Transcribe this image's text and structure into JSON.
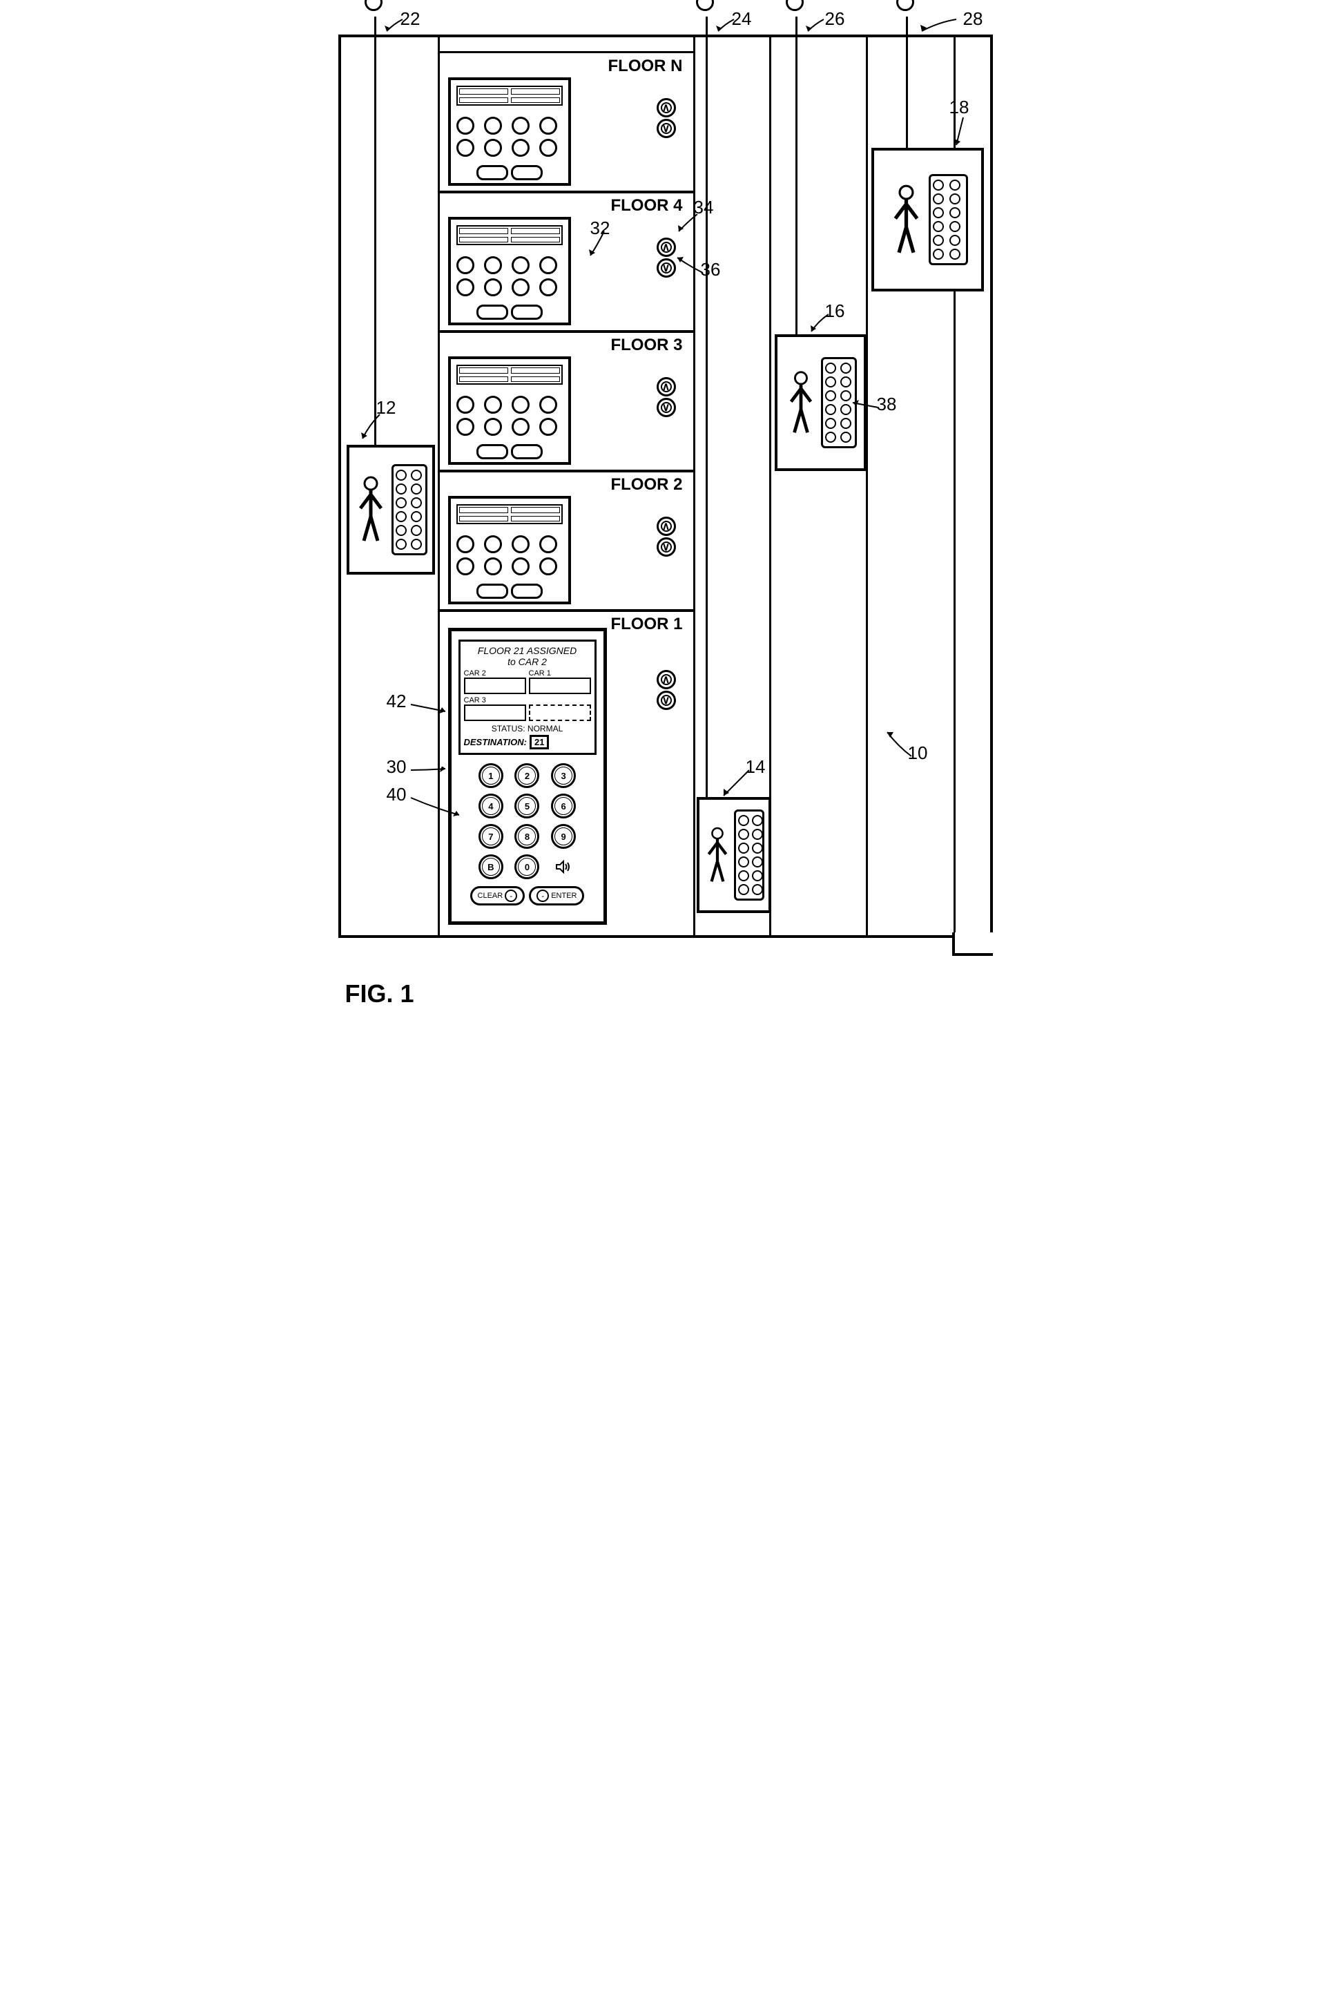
{
  "fig": "FIG. 1",
  "floors": {
    "n": "FLOOR N",
    "f4": "FLOOR 4",
    "f3": "FLOOR 3",
    "f2": "FLOOR 2",
    "f1": "FLOOR 1"
  },
  "refs": {
    "r10": "10",
    "r12": "12",
    "r14": "14",
    "r16": "16",
    "r18": "18",
    "r22": "22",
    "r24": "24",
    "r26": "26",
    "r28": "28",
    "r30": "30",
    "r32": "32",
    "r34": "34",
    "r36": "36",
    "r38": "38",
    "r40": "40",
    "r42": "42"
  },
  "screen": {
    "title1": "FLOOR 21 ASSIGNED",
    "title2": "to CAR 2",
    "car1": "CAR 1",
    "car2": "CAR 2",
    "car3": "CAR 3",
    "status": "STATUS: NORMAL",
    "destlabel": "DESTINATION:",
    "destval": "21"
  },
  "keypad": {
    "k1": "1",
    "k2": "2",
    "k3": "3",
    "k4": "4",
    "k5": "5",
    "k6": "6",
    "k7": "7",
    "k8": "8",
    "k9": "9",
    "kB": "B",
    "k0": "0",
    "clear": "CLEAR",
    "enter": "ENTER",
    "minus": "-"
  }
}
